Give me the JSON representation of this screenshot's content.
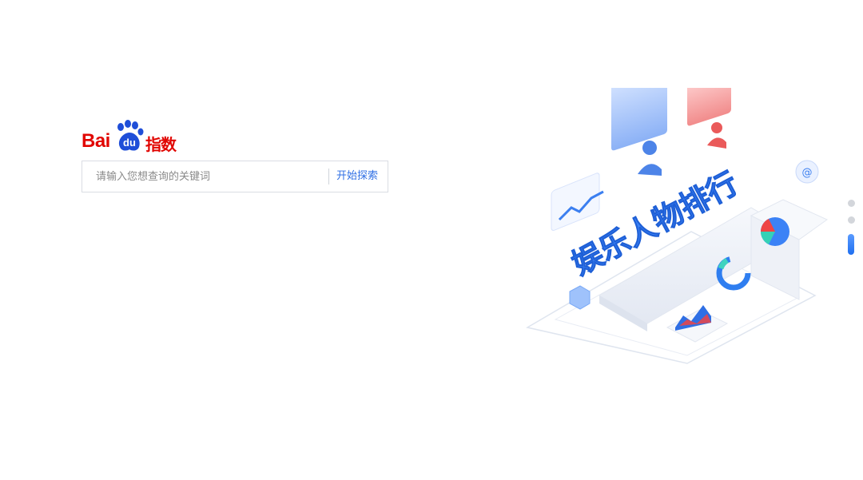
{
  "logo": {
    "brand_latin": "Bai",
    "brand_paw_text": "du",
    "brand_cjk": "指数",
    "color": "#e10602"
  },
  "search": {
    "placeholder": "请输入您想查询的关键词",
    "value": "",
    "button_label": "开始探索",
    "accent": "#2f6fe4"
  },
  "hero": {
    "banner_text": "娱乐人物排行",
    "accent": "#3b82f6"
  },
  "carousel": {
    "slide_count": 3,
    "active_index": 2
  }
}
